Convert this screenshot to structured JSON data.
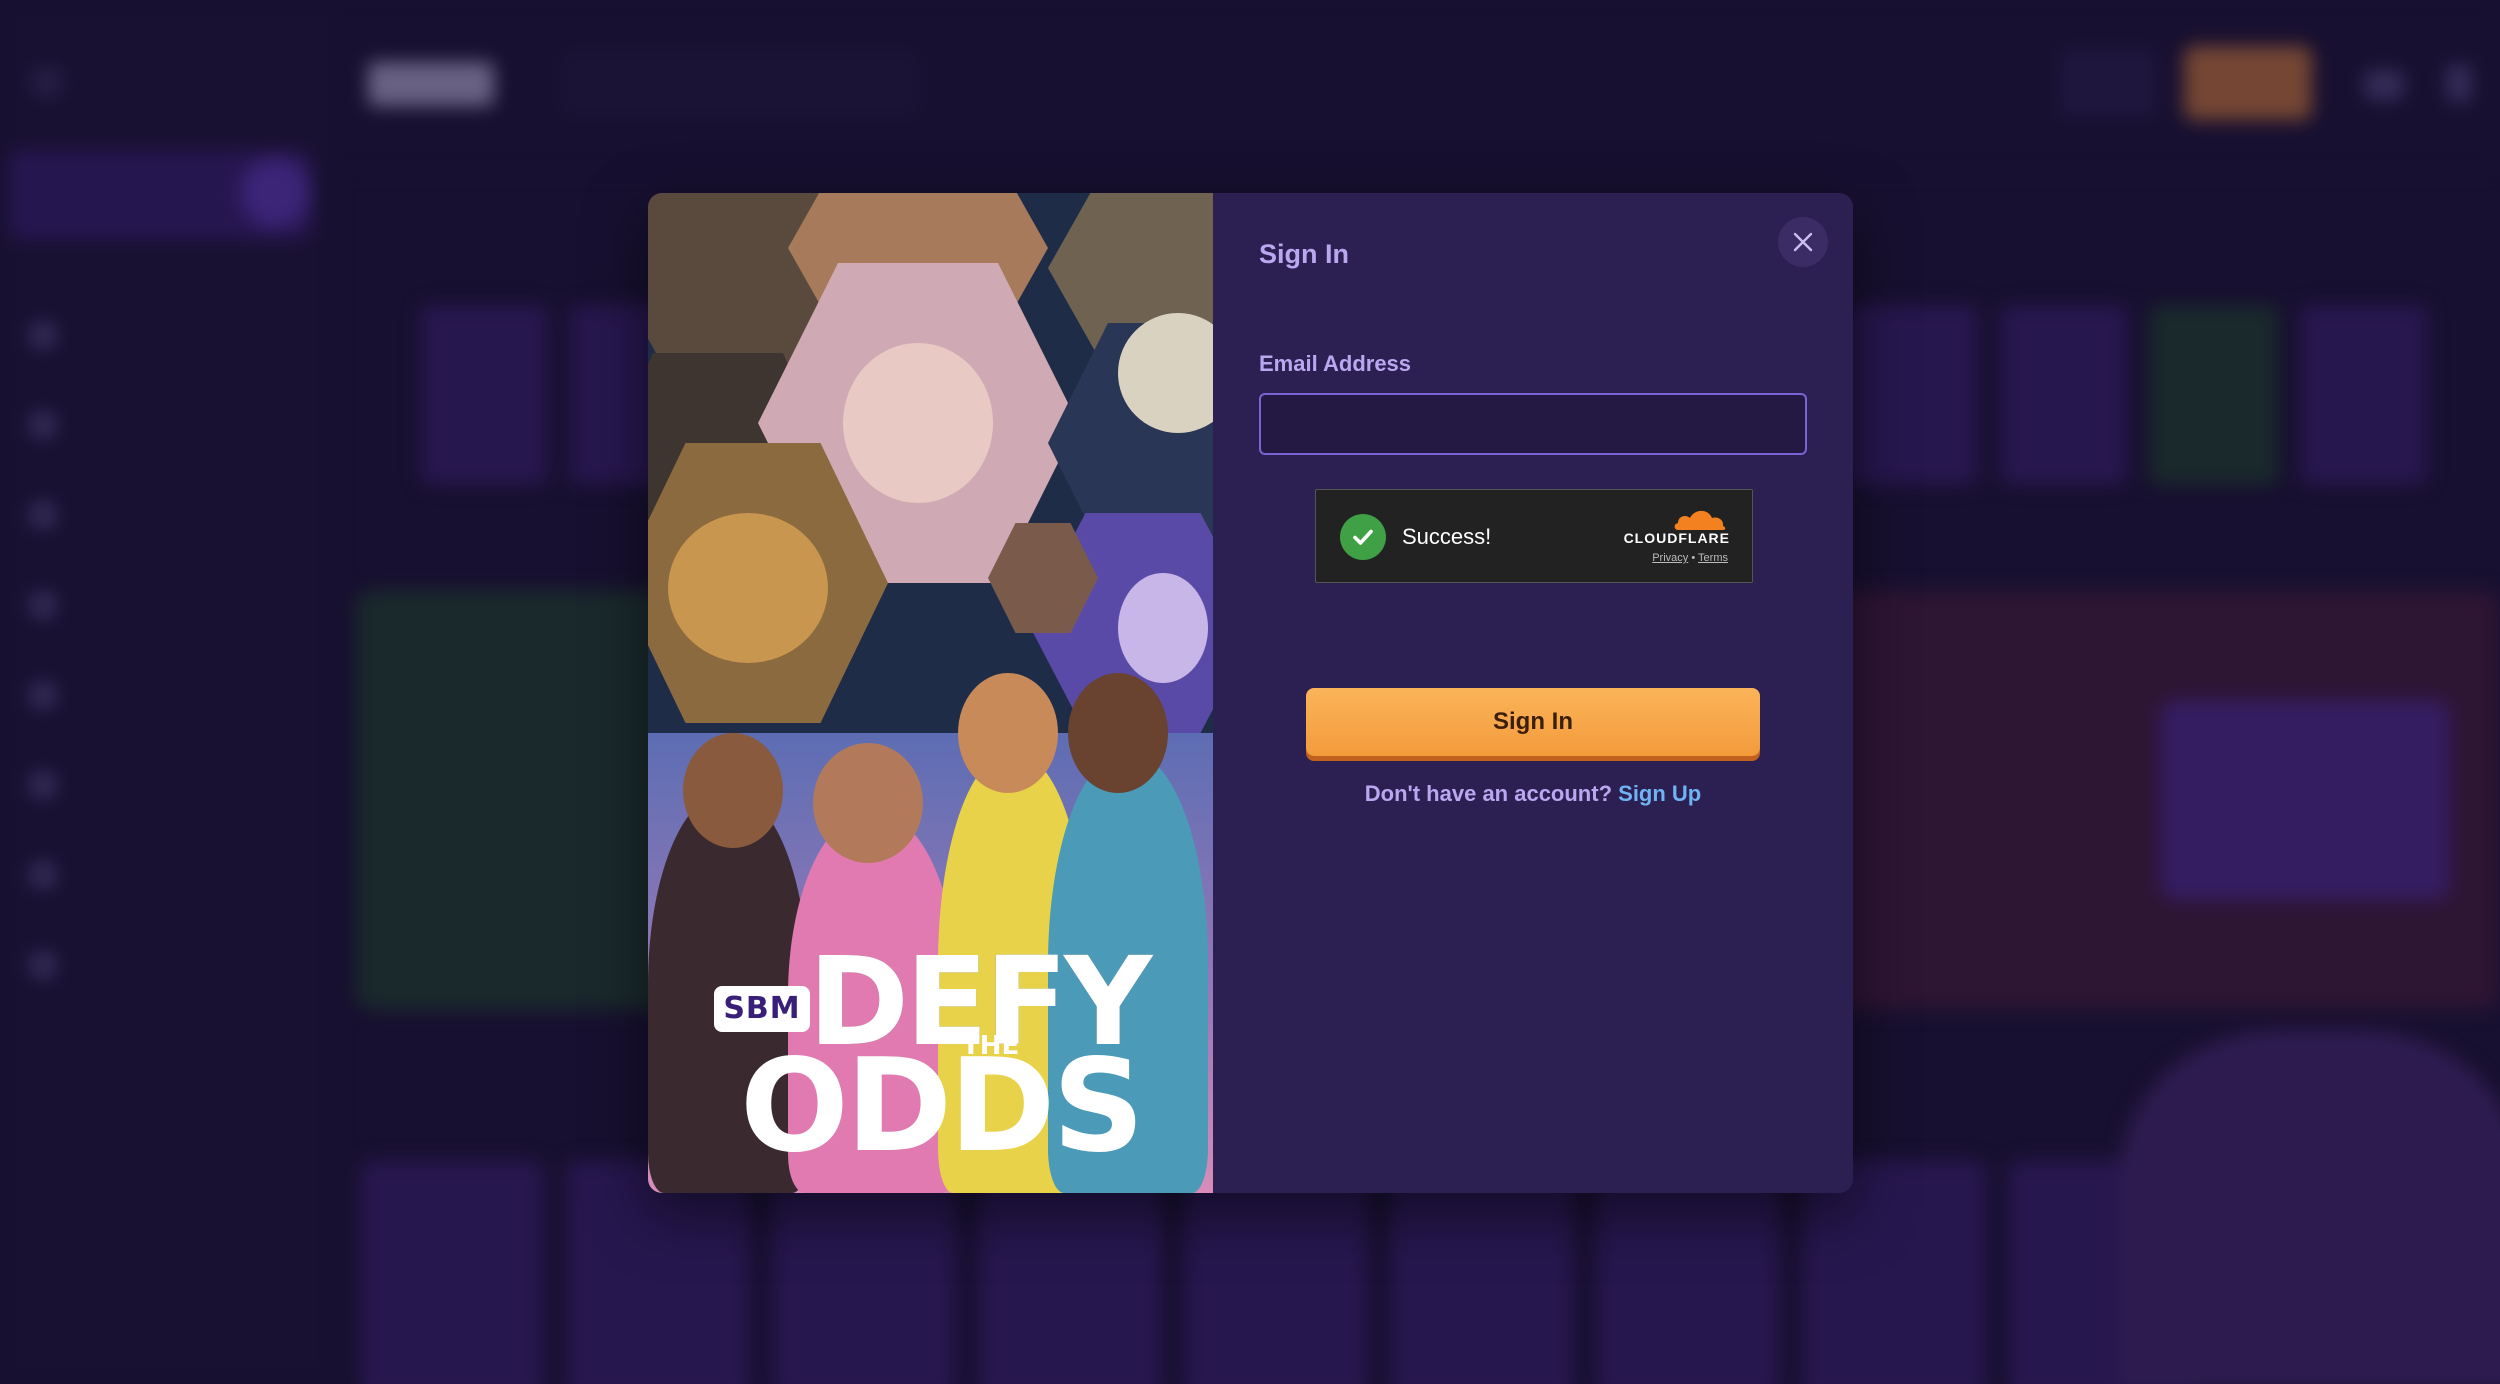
{
  "modal": {
    "title": "Sign In",
    "email_label": "Email Address",
    "email_value": "",
    "email_placeholder": "",
    "captcha": {
      "status": "Success!",
      "brand": "CLOUDFLARE",
      "privacy": "Privacy",
      "separator": "•",
      "terms": "Terms"
    },
    "submit_label": "Sign In",
    "signup_prompt": "Don't have an account?",
    "signup_link": "Sign Up"
  },
  "art": {
    "logo": "SBM",
    "line1": "DEFY",
    "line2": "THE",
    "line3": "ODDS"
  },
  "colors": {
    "accent": "#b9a8f0",
    "link": "#6fb3f5",
    "button": "#f39b3b",
    "success": "#40a046",
    "input_border": "#7a63d6"
  },
  "icons": {
    "close": "close-icon",
    "captcha_check": "checkmark-icon",
    "cloudflare": "cloudflare-logo-icon"
  }
}
